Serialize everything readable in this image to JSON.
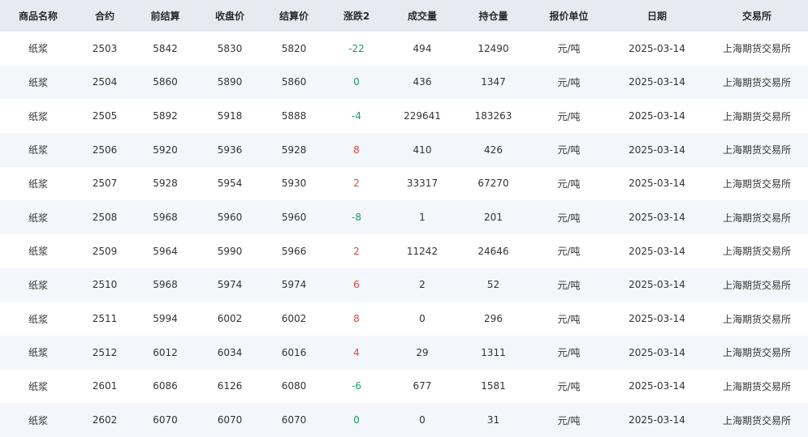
{
  "colors": {
    "up": "#e0463d",
    "down": "#1c9c63",
    "header_bg": "#e8eaf1",
    "stripe_bg": "#f3f6fa"
  },
  "table": {
    "headers": [
      "商品名称",
      "合约",
      "前结算",
      "收盘价",
      "结算价",
      "涨跌2",
      "成交量",
      "持仓量",
      "报价单位",
      "日期",
      "交易所"
    ],
    "rows": [
      [
        "纸浆",
        "2503",
        "5842",
        "5830",
        "5820",
        "-22",
        "494",
        "12490",
        "元/吨",
        "2025-03-14",
        "上海期货交易所"
      ],
      [
        "纸浆",
        "2504",
        "5860",
        "5890",
        "5860",
        "0",
        "436",
        "1347",
        "元/吨",
        "2025-03-14",
        "上海期货交易所"
      ],
      [
        "纸浆",
        "2505",
        "5892",
        "5918",
        "5888",
        "-4",
        "229641",
        "183263",
        "元/吨",
        "2025-03-14",
        "上海期货交易所"
      ],
      [
        "纸浆",
        "2506",
        "5920",
        "5936",
        "5928",
        "8",
        "410",
        "426",
        "元/吨",
        "2025-03-14",
        "上海期货交易所"
      ],
      [
        "纸浆",
        "2507",
        "5928",
        "5954",
        "5930",
        "2",
        "33317",
        "67270",
        "元/吨",
        "2025-03-14",
        "上海期货交易所"
      ],
      [
        "纸浆",
        "2508",
        "5968",
        "5960",
        "5960",
        "-8",
        "1",
        "201",
        "元/吨",
        "2025-03-14",
        "上海期货交易所"
      ],
      [
        "纸浆",
        "2509",
        "5964",
        "5990",
        "5966",
        "2",
        "11242",
        "24646",
        "元/吨",
        "2025-03-14",
        "上海期货交易所"
      ],
      [
        "纸浆",
        "2510",
        "5968",
        "5974",
        "5974",
        "6",
        "2",
        "52",
        "元/吨",
        "2025-03-14",
        "上海期货交易所"
      ],
      [
        "纸浆",
        "2511",
        "5994",
        "6002",
        "6002",
        "8",
        "0",
        "296",
        "元/吨",
        "2025-03-14",
        "上海期货交易所"
      ],
      [
        "纸浆",
        "2512",
        "6012",
        "6034",
        "6016",
        "4",
        "29",
        "1311",
        "元/吨",
        "2025-03-14",
        "上海期货交易所"
      ],
      [
        "纸浆",
        "2601",
        "6086",
        "6126",
        "6080",
        "-6",
        "677",
        "1581",
        "元/吨",
        "2025-03-14",
        "上海期货交易所"
      ],
      [
        "纸浆",
        "2602",
        "6070",
        "6070",
        "6070",
        "0",
        "0",
        "31",
        "元/吨",
        "2025-03-14",
        "上海期货交易所"
      ]
    ]
  }
}
